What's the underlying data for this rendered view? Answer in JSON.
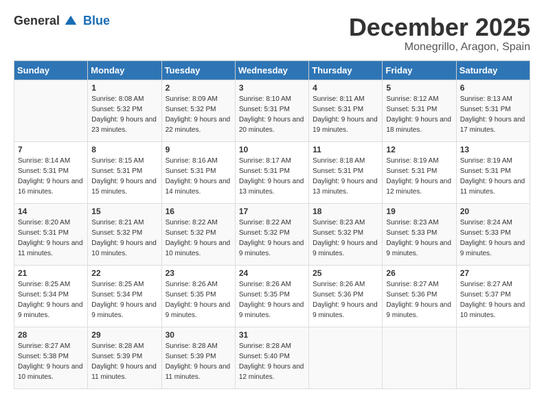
{
  "header": {
    "logo_general": "General",
    "logo_blue": "Blue",
    "month": "December 2025",
    "location": "Monegrillo, Aragon, Spain"
  },
  "days_of_week": [
    "Sunday",
    "Monday",
    "Tuesday",
    "Wednesday",
    "Thursday",
    "Friday",
    "Saturday"
  ],
  "weeks": [
    [
      {
        "day": "",
        "sunrise": "",
        "sunset": "",
        "daylight": ""
      },
      {
        "day": "1",
        "sunrise": "Sunrise: 8:08 AM",
        "sunset": "Sunset: 5:32 PM",
        "daylight": "Daylight: 9 hours and 23 minutes."
      },
      {
        "day": "2",
        "sunrise": "Sunrise: 8:09 AM",
        "sunset": "Sunset: 5:32 PM",
        "daylight": "Daylight: 9 hours and 22 minutes."
      },
      {
        "day": "3",
        "sunrise": "Sunrise: 8:10 AM",
        "sunset": "Sunset: 5:31 PM",
        "daylight": "Daylight: 9 hours and 20 minutes."
      },
      {
        "day": "4",
        "sunrise": "Sunrise: 8:11 AM",
        "sunset": "Sunset: 5:31 PM",
        "daylight": "Daylight: 9 hours and 19 minutes."
      },
      {
        "day": "5",
        "sunrise": "Sunrise: 8:12 AM",
        "sunset": "Sunset: 5:31 PM",
        "daylight": "Daylight: 9 hours and 18 minutes."
      },
      {
        "day": "6",
        "sunrise": "Sunrise: 8:13 AM",
        "sunset": "Sunset: 5:31 PM",
        "daylight": "Daylight: 9 hours and 17 minutes."
      }
    ],
    [
      {
        "day": "7",
        "sunrise": "Sunrise: 8:14 AM",
        "sunset": "Sunset: 5:31 PM",
        "daylight": "Daylight: 9 hours and 16 minutes."
      },
      {
        "day": "8",
        "sunrise": "Sunrise: 8:15 AM",
        "sunset": "Sunset: 5:31 PM",
        "daylight": "Daylight: 9 hours and 15 minutes."
      },
      {
        "day": "9",
        "sunrise": "Sunrise: 8:16 AM",
        "sunset": "Sunset: 5:31 PM",
        "daylight": "Daylight: 9 hours and 14 minutes."
      },
      {
        "day": "10",
        "sunrise": "Sunrise: 8:17 AM",
        "sunset": "Sunset: 5:31 PM",
        "daylight": "Daylight: 9 hours and 13 minutes."
      },
      {
        "day": "11",
        "sunrise": "Sunrise: 8:18 AM",
        "sunset": "Sunset: 5:31 PM",
        "daylight": "Daylight: 9 hours and 13 minutes."
      },
      {
        "day": "12",
        "sunrise": "Sunrise: 8:19 AM",
        "sunset": "Sunset: 5:31 PM",
        "daylight": "Daylight: 9 hours and 12 minutes."
      },
      {
        "day": "13",
        "sunrise": "Sunrise: 8:19 AM",
        "sunset": "Sunset: 5:31 PM",
        "daylight": "Daylight: 9 hours and 11 minutes."
      }
    ],
    [
      {
        "day": "14",
        "sunrise": "Sunrise: 8:20 AM",
        "sunset": "Sunset: 5:31 PM",
        "daylight": "Daylight: 9 hours and 11 minutes."
      },
      {
        "day": "15",
        "sunrise": "Sunrise: 8:21 AM",
        "sunset": "Sunset: 5:32 PM",
        "daylight": "Daylight: 9 hours and 10 minutes."
      },
      {
        "day": "16",
        "sunrise": "Sunrise: 8:22 AM",
        "sunset": "Sunset: 5:32 PM",
        "daylight": "Daylight: 9 hours and 10 minutes."
      },
      {
        "day": "17",
        "sunrise": "Sunrise: 8:22 AM",
        "sunset": "Sunset: 5:32 PM",
        "daylight": "Daylight: 9 hours and 9 minutes."
      },
      {
        "day": "18",
        "sunrise": "Sunrise: 8:23 AM",
        "sunset": "Sunset: 5:32 PM",
        "daylight": "Daylight: 9 hours and 9 minutes."
      },
      {
        "day": "19",
        "sunrise": "Sunrise: 8:23 AM",
        "sunset": "Sunset: 5:33 PM",
        "daylight": "Daylight: 9 hours and 9 minutes."
      },
      {
        "day": "20",
        "sunrise": "Sunrise: 8:24 AM",
        "sunset": "Sunset: 5:33 PM",
        "daylight": "Daylight: 9 hours and 9 minutes."
      }
    ],
    [
      {
        "day": "21",
        "sunrise": "Sunrise: 8:25 AM",
        "sunset": "Sunset: 5:34 PM",
        "daylight": "Daylight: 9 hours and 9 minutes."
      },
      {
        "day": "22",
        "sunrise": "Sunrise: 8:25 AM",
        "sunset": "Sunset: 5:34 PM",
        "daylight": "Daylight: 9 hours and 9 minutes."
      },
      {
        "day": "23",
        "sunrise": "Sunrise: 8:26 AM",
        "sunset": "Sunset: 5:35 PM",
        "daylight": "Daylight: 9 hours and 9 minutes."
      },
      {
        "day": "24",
        "sunrise": "Sunrise: 8:26 AM",
        "sunset": "Sunset: 5:35 PM",
        "daylight": "Daylight: 9 hours and 9 minutes."
      },
      {
        "day": "25",
        "sunrise": "Sunrise: 8:26 AM",
        "sunset": "Sunset: 5:36 PM",
        "daylight": "Daylight: 9 hours and 9 minutes."
      },
      {
        "day": "26",
        "sunrise": "Sunrise: 8:27 AM",
        "sunset": "Sunset: 5:36 PM",
        "daylight": "Daylight: 9 hours and 9 minutes."
      },
      {
        "day": "27",
        "sunrise": "Sunrise: 8:27 AM",
        "sunset": "Sunset: 5:37 PM",
        "daylight": "Daylight: 9 hours and 10 minutes."
      }
    ],
    [
      {
        "day": "28",
        "sunrise": "Sunrise: 8:27 AM",
        "sunset": "Sunset: 5:38 PM",
        "daylight": "Daylight: 9 hours and 10 minutes."
      },
      {
        "day": "29",
        "sunrise": "Sunrise: 8:28 AM",
        "sunset": "Sunset: 5:39 PM",
        "daylight": "Daylight: 9 hours and 11 minutes."
      },
      {
        "day": "30",
        "sunrise": "Sunrise: 8:28 AM",
        "sunset": "Sunset: 5:39 PM",
        "daylight": "Daylight: 9 hours and 11 minutes."
      },
      {
        "day": "31",
        "sunrise": "Sunrise: 8:28 AM",
        "sunset": "Sunset: 5:40 PM",
        "daylight": "Daylight: 9 hours and 12 minutes."
      },
      {
        "day": "",
        "sunrise": "",
        "sunset": "",
        "daylight": ""
      },
      {
        "day": "",
        "sunrise": "",
        "sunset": "",
        "daylight": ""
      },
      {
        "day": "",
        "sunrise": "",
        "sunset": "",
        "daylight": ""
      }
    ]
  ]
}
